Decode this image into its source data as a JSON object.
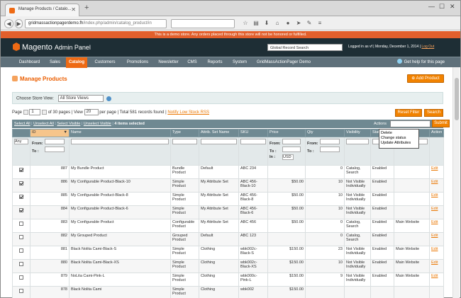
{
  "browser": {
    "tab_title": "Manage Products / Catalo...",
    "url_host": "gridmassactionpagerdemo.fh",
    "url_path": "/index.php/admin/catalog_product/in",
    "search_placeholder": ""
  },
  "demo_notice": "This is a demo store. Any orders placed through this store will not be honored or fulfilled.",
  "header": {
    "logo": "Magento",
    "logo_sub": "Admin Panel",
    "global_search": "Global Record Search",
    "logged_in": "Logged in as vf",
    "date": "Monday, December 1, 2014",
    "logout": "Log Out"
  },
  "menu": {
    "items": [
      "Dashboard",
      "Sales",
      "Catalog",
      "Customers",
      "Promotions",
      "Newsletter",
      "CMS",
      "Reports",
      "System",
      "GridMassActionPager Demo"
    ],
    "help": "Get help for this page"
  },
  "page": {
    "title": "Manage Products",
    "add_button": "Add Product"
  },
  "store": {
    "label": "Choose Store View:",
    "value": "All Store Views"
  },
  "pager": {
    "page_label": "Page",
    "page": "1",
    "of_pages": "of 30 pages",
    "view_label": "View",
    "per_page": "20",
    "per_page_label": "per page",
    "total": "Total 581 records found",
    "rss": "Notify Low Stock RSS",
    "reset": "Reset Filter",
    "search": "Search"
  },
  "mass": {
    "select_all": "Select All",
    "unselect_all": "Unselect All",
    "select_visible": "Select Visible",
    "unselect_visible": "Unselect Visible",
    "selected": "4 items selected",
    "actions_label": "Actions",
    "submit": "Submit",
    "options": [
      "Delete",
      "Change status",
      "Update Attributes"
    ]
  },
  "columns": [
    "",
    "ID",
    "Name",
    "Type",
    "Attrib. Set Name",
    "SKU",
    "Price",
    "Qty",
    "Visibility",
    "Status",
    "Websites",
    "Action"
  ],
  "filters": {
    "any": "Any",
    "from": "From:",
    "to": "To :",
    "in": "In :",
    "currency": "USD"
  },
  "rows": [
    {
      "checked": true,
      "id": "887",
      "name": "My Bundle Product",
      "type": "Bundle Product",
      "set": "Default",
      "sku": "ABC 234",
      "price": "",
      "qty": "0",
      "vis": "Catalog, Search",
      "status": "Enabled",
      "web": "",
      "action": "Edit"
    },
    {
      "checked": true,
      "id": "886",
      "name": "My Configurable Product-Black-10",
      "type": "Simple Product",
      "set": "My Attribute Set",
      "sku": "ABC 456-Black-10",
      "price": "$50.00",
      "qty": "10",
      "vis": "Not Visible Individually",
      "status": "Enabled",
      "web": "",
      "action": "Edit"
    },
    {
      "checked": true,
      "id": "885",
      "name": "My Configurable Product-Black-8",
      "type": "Simple Product",
      "set": "My Attribute Set",
      "sku": "ABC 456-Black-8",
      "price": "$50.00",
      "qty": "10",
      "vis": "Not Visible Individually",
      "status": "Enabled",
      "web": "",
      "action": "Edit"
    },
    {
      "checked": true,
      "id": "884",
      "name": "My Configurable Product-Black-6",
      "type": "Simple Product",
      "set": "My Attribute Set",
      "sku": "ABC 456-Black-6",
      "price": "$50.00",
      "qty": "10",
      "vis": "Not Visible Individually",
      "status": "Enabled",
      "web": "",
      "action": "Edit"
    },
    {
      "checked": false,
      "id": "883",
      "name": "My Configurable Product",
      "type": "Configurable Product",
      "set": "My Attribute Set",
      "sku": "ABC 456",
      "price": "$50.00",
      "qty": "0",
      "vis": "Catalog, Search",
      "status": "Enabled",
      "web": "Main Website",
      "action": "Edit"
    },
    {
      "checked": false,
      "id": "882",
      "name": "My Grouped Product",
      "type": "Grouped Product",
      "set": "Default",
      "sku": "ABC 123",
      "price": "",
      "qty": "0",
      "vis": "Catalog, Search",
      "status": "Enabled",
      "web": "",
      "action": "Edit"
    },
    {
      "checked": false,
      "id": "881",
      "name": "Black Nolita Cami-Black-S",
      "type": "Simple Product",
      "set": "Clothing",
      "sku": "wbk002c-Black-S",
      "price": "$150.00",
      "qty": "23",
      "vis": "Not Visible Individually",
      "status": "Enabled",
      "web": "Main Website",
      "action": "Edit"
    },
    {
      "checked": false,
      "id": "880",
      "name": "Black Nolita Cami-Black-XS",
      "type": "Simple Product",
      "set": "Clothing",
      "sku": "wbk002c-Black-XS",
      "price": "$150.00",
      "qty": "10",
      "vis": "Not Visible Individually",
      "status": "Enabled",
      "web": "Main Website",
      "action": "Edit"
    },
    {
      "checked": false,
      "id": "879",
      "name": "NoLita Cami-Pink-L",
      "type": "Simple Product",
      "set": "Clothing",
      "sku": "wbk000c-Pink-L",
      "price": "$150.00",
      "qty": "9",
      "vis": "Not Visible Individually",
      "status": "Enabled",
      "web": "Main Website",
      "action": "Edit"
    },
    {
      "checked": false,
      "id": "878",
      "name": "Black Nolita Cami",
      "type": "Simple Product",
      "set": "Clothing",
      "sku": "wbk002",
      "price": "$150.00",
      "qty": "",
      "vis": "",
      "status": "",
      "web": "",
      "action": ""
    }
  ]
}
